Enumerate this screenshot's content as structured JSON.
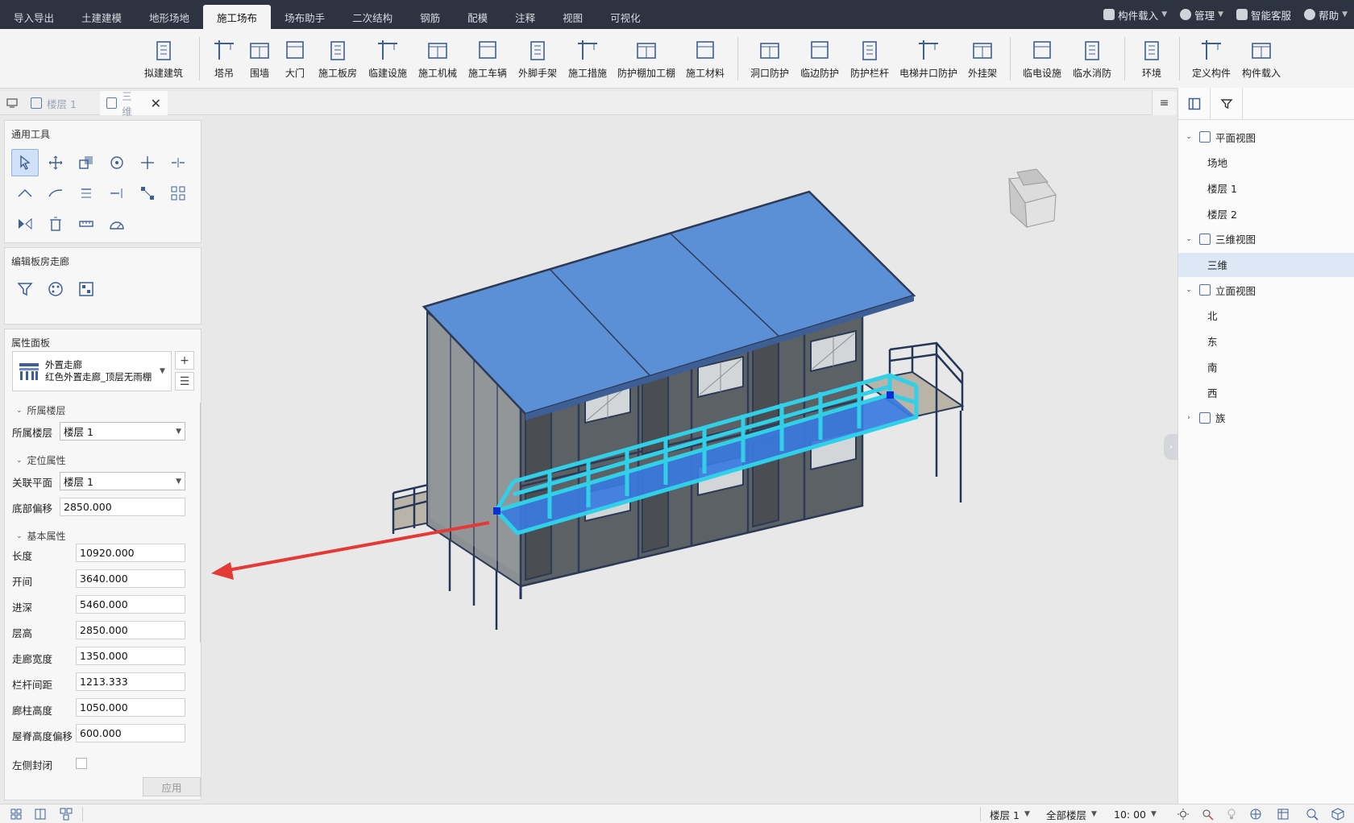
{
  "menu": {
    "tabs": [
      "导入导出",
      "土建建模",
      "地形场地",
      "施工场布",
      "场布助手",
      "二次结构",
      "钢筋",
      "配模",
      "注释",
      "视图",
      "可视化"
    ],
    "active_index": 3,
    "right": {
      "load_component": "构件载入",
      "manage": "管理",
      "service": "智能客服",
      "help": "帮助"
    }
  },
  "ribbon": {
    "groups": [
      [
        "拟建建筑"
      ],
      [
        "塔吊",
        "围墙",
        "大门",
        "施工板房",
        "临建设施",
        "施工机械",
        "施工车辆",
        "外脚手架",
        "施工措施",
        "防护棚加工棚",
        "施工材料"
      ],
      [
        "洞口防护",
        "临边防护",
        "防护栏杆",
        "电梯井口防护",
        "外挂架"
      ],
      [
        "临电设施",
        "临水消防"
      ],
      [
        "环境"
      ],
      [
        "定义构件",
        "构件载入"
      ]
    ]
  },
  "doc_tabs": {
    "tab1": "楼层 1",
    "tab2": "三维",
    "menu_icon": "≡"
  },
  "left_panel": {
    "general_tools_title": "通用工具",
    "edit_title": "编辑板房走廊",
    "property_title": "属性面板",
    "type_name": "外置走廊",
    "type_sub": "红色外置走廊_顶层无雨棚",
    "sections": {
      "floor": "所属楼层",
      "position": "定位属性",
      "basic": "基本属性"
    },
    "floor_label": "所属楼层",
    "floor_value": "楼层 1",
    "assoc_label": "关联平面",
    "assoc_value": "楼层 1",
    "bottom_offset_label": "底部偏移",
    "bottom_offset_value": "2850.000",
    "basic_props": [
      {
        "label": "长度",
        "value": "10920.000"
      },
      {
        "label": "开间",
        "value": "3640.000"
      },
      {
        "label": "进深",
        "value": "5460.000"
      },
      {
        "label": "层高",
        "value": "2850.000"
      },
      {
        "label": "走廊宽度",
        "value": "1350.000"
      },
      {
        "label": "栏杆间距",
        "value": "1213.333"
      },
      {
        "label": "廊柱高度",
        "value": "1050.000"
      },
      {
        "label": "屋脊高度偏移",
        "value": "600.000"
      }
    ],
    "left_closed_label": "左侧封闭",
    "apply": "应用"
  },
  "tree": {
    "plan_view": "平面视图",
    "plan_items": [
      "场地",
      "楼层 1",
      "楼层 2"
    ],
    "view3d": "三维视图",
    "view3d_items": [
      "三维"
    ],
    "elevation": "立面视图",
    "elevation_items": [
      "北",
      "东",
      "南",
      "西"
    ],
    "family": "族"
  },
  "status": {
    "floor": "楼层 1",
    "all_floors": "全部楼层",
    "scale": "10: 00"
  },
  "colors": {
    "roof": "#5b8fd6",
    "wall": "#5f6368",
    "selected_corridor": "#2fd0e8",
    "arrow": "#e53935"
  }
}
